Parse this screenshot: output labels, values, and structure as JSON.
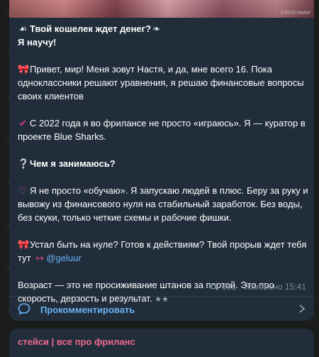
{
  "post": {
    "photo_credit": "©2020 Mattel",
    "headline_1": "Твой кошелек ждет денег?",
    "headline_2": "Я научу!",
    "p1": "Привет, мир! Меня зовут Настя, и да, мне всего 16. Пока одноклассники решают уравнения, я решаю финансовые вопросы своих клиентов",
    "p2": "С 2022 года я во фрилансе не просто «играюсь». Я — куратор в проекте Blue Sharks.",
    "p3": "Чем я занимаюсь?",
    "p4": "Я не просто «обучаю». Я запускаю людей в плюс. Беру за руку и вывожу из финансового нуля на стабильный заработок. Без воды, без скуки, только четкие схемы и рабочие фишки.",
    "p5": "Устал быть на нуле? Готов к действиям? Твой прорыв ждет тебя тут",
    "mention": "@geluur",
    "p6": "Возраст — это не просиживание штанов за партой. Это про скорость, дерзость и результат.",
    "views": "181",
    "edited": "изменено 15:41"
  },
  "comment_label": "Прокомментировать",
  "next_post": {
    "channel_title": "стейси | все про фриланс"
  },
  "colors": {
    "accent": "#6ab3f3",
    "channel_name": "#ee6a8b",
    "bubble": "#212d3b",
    "check": "#e0388a"
  },
  "icons": [
    "wing-icon",
    "ribbon-icon",
    "check-icon",
    "question-icon",
    "heart-icon",
    "ribbon-icon",
    "arrow-icon",
    "stars-icon",
    "eye-icon",
    "comment-icon",
    "chevron-right-icon"
  ]
}
